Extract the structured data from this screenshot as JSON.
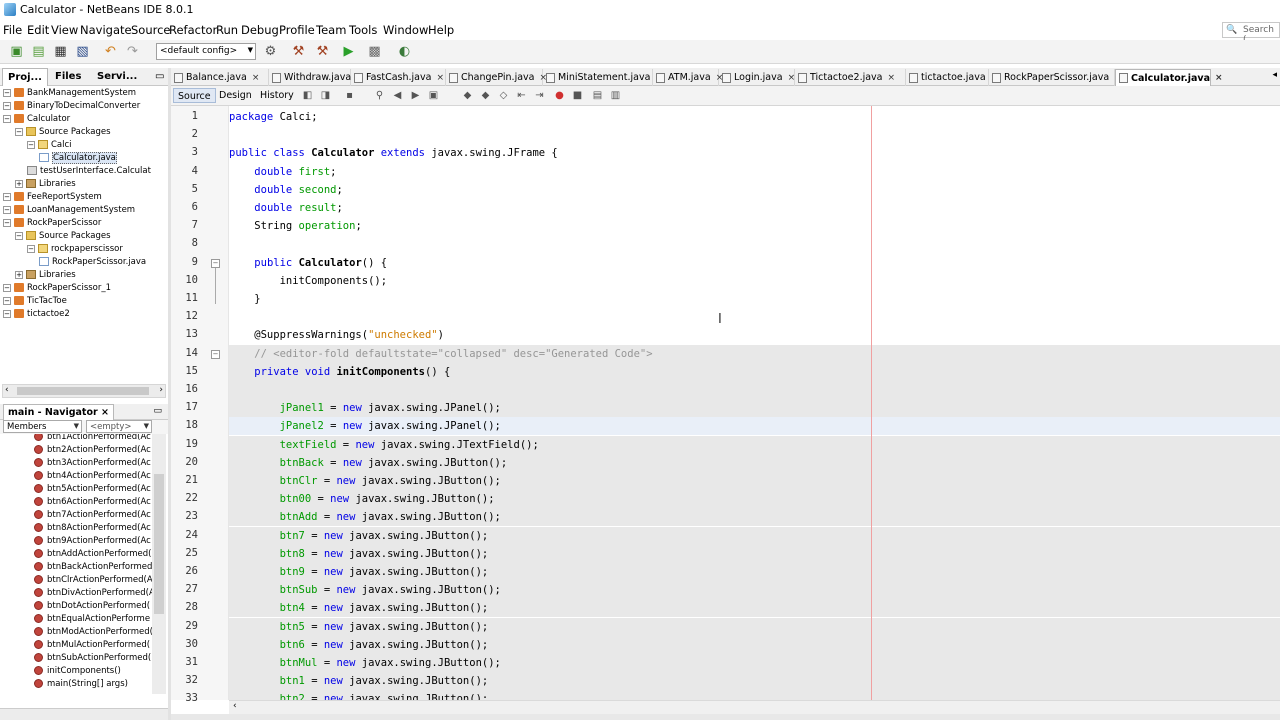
{
  "window": {
    "title": "Calculator - NetBeans IDE 8.0.1"
  },
  "menu": [
    "File",
    "Edit",
    "View",
    "Navigate",
    "Source",
    "Refactor",
    "Run",
    "Debug",
    "Profile",
    "Team",
    "Tools",
    "Window",
    "Help"
  ],
  "search": {
    "placeholder": "Search ("
  },
  "toolbar": {
    "config": "<default config>"
  },
  "project_tabs": [
    "Proj...",
    "Files",
    "Servi..."
  ],
  "project_tree": [
    {
      "label": "BankManagementSystem",
      "depth": 0,
      "icon": "proj"
    },
    {
      "label": "BinaryToDecimalConverter",
      "depth": 0,
      "icon": "proj"
    },
    {
      "label": "Calculator",
      "depth": 0,
      "icon": "proj"
    },
    {
      "label": "Source Packages",
      "depth": 1,
      "icon": "folder"
    },
    {
      "label": "Calci",
      "depth": 2,
      "icon": "pkg"
    },
    {
      "label": "Calculator.java",
      "depth": 3,
      "icon": "file"
    },
    {
      "label": "testUserInterface.Calculat",
      "depth": 2,
      "icon": "test"
    },
    {
      "label": "Libraries",
      "depth": 1,
      "icon": "lib"
    },
    {
      "label": "FeeReportSystem",
      "depth": 0,
      "icon": "proj"
    },
    {
      "label": "LoanManagementSystem",
      "depth": 0,
      "icon": "proj"
    },
    {
      "label": "RockPaperScissor",
      "depth": 0,
      "icon": "proj"
    },
    {
      "label": "Source Packages",
      "depth": 1,
      "icon": "folder"
    },
    {
      "label": "rockpaperscissor",
      "depth": 2,
      "icon": "pkg"
    },
    {
      "label": "RockPaperScissor.java",
      "depth": 3,
      "icon": "file"
    },
    {
      "label": "Libraries",
      "depth": 1,
      "icon": "lib"
    },
    {
      "label": "RockPaperScissor_1",
      "depth": 0,
      "icon": "proj"
    },
    {
      "label": "TicTacToe",
      "depth": 0,
      "icon": "proj"
    },
    {
      "label": "tictactoe2",
      "depth": 0,
      "icon": "proj"
    }
  ],
  "navigator": {
    "title": "main - Navigator",
    "close": "×",
    "filter_mode": "Members",
    "filter_value": "<empty>",
    "items": [
      "btn1ActionPerformed(Ac",
      "btn2ActionPerformed(Ac",
      "btn3ActionPerformed(Ac",
      "btn4ActionPerformed(Ac",
      "btn5ActionPerformed(Ac",
      "btn6ActionPerformed(Ac",
      "btn7ActionPerformed(Ac",
      "btn8ActionPerformed(Ac",
      "btn9ActionPerformed(Ac",
      "btnAddActionPerformed(",
      "btnBackActionPerformed",
      "btnClrActionPerformed(A",
      "btnDivActionPerformed(A",
      "btnDotActionPerformed(",
      "btnEqualActionPerforme",
      "btnModActionPerformed(",
      "btnMulActionPerformed(",
      "btnSubActionPerformed(",
      "initComponents()",
      "main(String[] args)"
    ]
  },
  "editor_tabs": [
    {
      "label": "Balance.java",
      "active": false
    },
    {
      "label": "Withdraw.java",
      "active": false
    },
    {
      "label": "FastCash.java",
      "active": false
    },
    {
      "label": "ChangePin.java",
      "active": false
    },
    {
      "label": "MiniStatement.java",
      "active": false
    },
    {
      "label": "ATM.java",
      "active": false
    },
    {
      "label": "Login.java",
      "active": false
    },
    {
      "label": "Tictactoe2.java",
      "active": false
    },
    {
      "label": "tictactoe.java",
      "active": false
    },
    {
      "label": "RockPaperScissor.java",
      "active": false
    },
    {
      "label": "Calculator.java",
      "active": true
    }
  ],
  "editor_view_tabs": [
    "Source",
    "Design",
    "History"
  ],
  "code": {
    "first_line": 1,
    "lines": [
      [
        [
          "kw",
          "package"
        ],
        [
          "typ",
          " Calci;"
        ]
      ],
      [],
      [
        [
          "kw",
          "public class "
        ],
        [
          "fn",
          "Calculator"
        ],
        [
          "kw",
          " extends "
        ],
        [
          "typ",
          "javax.swing.JFrame {"
        ]
      ],
      [
        [
          "typ",
          "    "
        ],
        [
          "kw",
          "double "
        ],
        [
          "fld",
          "first"
        ],
        [
          "typ",
          ";"
        ]
      ],
      [
        [
          "typ",
          "    "
        ],
        [
          "kw",
          "double "
        ],
        [
          "fld",
          "second"
        ],
        [
          "typ",
          ";"
        ]
      ],
      [
        [
          "typ",
          "    "
        ],
        [
          "kw",
          "double "
        ],
        [
          "fld",
          "result"
        ],
        [
          "typ",
          ";"
        ]
      ],
      [
        [
          "typ",
          "    String "
        ],
        [
          "fld",
          "operation"
        ],
        [
          "typ",
          ";"
        ]
      ],
      [],
      [
        [
          "typ",
          "    "
        ],
        [
          "kw",
          "public "
        ],
        [
          "fn",
          "Calculator"
        ],
        [
          "typ",
          "() {"
        ]
      ],
      [
        [
          "typ",
          "        initComponents();"
        ]
      ],
      [
        [
          "typ",
          "    }"
        ]
      ],
      [],
      [
        [
          "typ",
          "    @SuppressWarnings("
        ],
        [
          "str",
          "\"unchecked\""
        ],
        [
          "typ",
          ")"
        ]
      ],
      [
        [
          "cmt",
          "    // <editor-fold defaultstate=\"collapsed\" desc=\"Generated Code\">"
        ]
      ],
      [
        [
          "typ",
          "    "
        ],
        [
          "kw",
          "private void "
        ],
        [
          "fn",
          "initComponents"
        ],
        [
          "typ",
          "() {"
        ]
      ],
      [],
      [
        [
          "typ",
          "        "
        ],
        [
          "fld",
          "jPanel1"
        ],
        [
          "typ",
          " = "
        ],
        [
          "kw",
          "new "
        ],
        [
          "typ",
          "javax.swing.JPanel();"
        ]
      ],
      [
        [
          "typ",
          "        "
        ],
        [
          "fld",
          "jPanel2"
        ],
        [
          "typ",
          " = "
        ],
        [
          "kw",
          "new "
        ],
        [
          "typ",
          "javax.swing.JPanel();"
        ]
      ],
      [
        [
          "typ",
          "        "
        ],
        [
          "fld",
          "textField"
        ],
        [
          "typ",
          " = "
        ],
        [
          "kw",
          "new "
        ],
        [
          "typ",
          "javax.swing.JTextField();"
        ]
      ],
      [
        [
          "typ",
          "        "
        ],
        [
          "fld",
          "btnBack"
        ],
        [
          "typ",
          " = "
        ],
        [
          "kw",
          "new "
        ],
        [
          "typ",
          "javax.swing.JButton();"
        ]
      ],
      [
        [
          "typ",
          "        "
        ],
        [
          "fld",
          "btnClr"
        ],
        [
          "typ",
          " = "
        ],
        [
          "kw",
          "new "
        ],
        [
          "typ",
          "javax.swing.JButton();"
        ]
      ],
      [
        [
          "typ",
          "        "
        ],
        [
          "fld",
          "btn00"
        ],
        [
          "typ",
          " = "
        ],
        [
          "kw",
          "new "
        ],
        [
          "typ",
          "javax.swing.JButton();"
        ]
      ],
      [
        [
          "typ",
          "        "
        ],
        [
          "fld",
          "btnAdd"
        ],
        [
          "typ",
          " = "
        ],
        [
          "kw",
          "new "
        ],
        [
          "typ",
          "javax.swing.JButton();"
        ]
      ],
      [
        [
          "typ",
          "        "
        ],
        [
          "fld",
          "btn7"
        ],
        [
          "typ",
          " = "
        ],
        [
          "kw",
          "new "
        ],
        [
          "typ",
          "javax.swing.JButton();"
        ]
      ],
      [
        [
          "typ",
          "        "
        ],
        [
          "fld",
          "btn8"
        ],
        [
          "typ",
          " = "
        ],
        [
          "kw",
          "new "
        ],
        [
          "typ",
          "javax.swing.JButton();"
        ]
      ],
      [
        [
          "typ",
          "        "
        ],
        [
          "fld",
          "btn9"
        ],
        [
          "typ",
          " = "
        ],
        [
          "kw",
          "new "
        ],
        [
          "typ",
          "javax.swing.JButton();"
        ]
      ],
      [
        [
          "typ",
          "        "
        ],
        [
          "fld",
          "btnSub"
        ],
        [
          "typ",
          " = "
        ],
        [
          "kw",
          "new "
        ],
        [
          "typ",
          "javax.swing.JButton();"
        ]
      ],
      [
        [
          "typ",
          "        "
        ],
        [
          "fld",
          "btn4"
        ],
        [
          "typ",
          " = "
        ],
        [
          "kw",
          "new "
        ],
        [
          "typ",
          "javax.swing.JButton();"
        ]
      ],
      [
        [
          "typ",
          "        "
        ],
        [
          "fld",
          "btn5"
        ],
        [
          "typ",
          " = "
        ],
        [
          "kw",
          "new "
        ],
        [
          "typ",
          "javax.swing.JButton();"
        ]
      ],
      [
        [
          "typ",
          "        "
        ],
        [
          "fld",
          "btn6"
        ],
        [
          "typ",
          " = "
        ],
        [
          "kw",
          "new "
        ],
        [
          "typ",
          "javax.swing.JButton();"
        ]
      ],
      [
        [
          "typ",
          "        "
        ],
        [
          "fld",
          "btnMul"
        ],
        [
          "typ",
          " = "
        ],
        [
          "kw",
          "new "
        ],
        [
          "typ",
          "javax.swing.JButton();"
        ]
      ],
      [
        [
          "typ",
          "        "
        ],
        [
          "fld",
          "btn1"
        ],
        [
          "typ",
          " = "
        ],
        [
          "kw",
          "new "
        ],
        [
          "typ",
          "javax.swing.JButton();"
        ]
      ],
      [
        [
          "typ",
          "        "
        ],
        [
          "fld",
          "btn2"
        ],
        [
          "typ",
          " = "
        ],
        [
          "kw",
          "new "
        ],
        [
          "typ",
          "javax.swing.JButton();"
        ]
      ]
    ]
  }
}
